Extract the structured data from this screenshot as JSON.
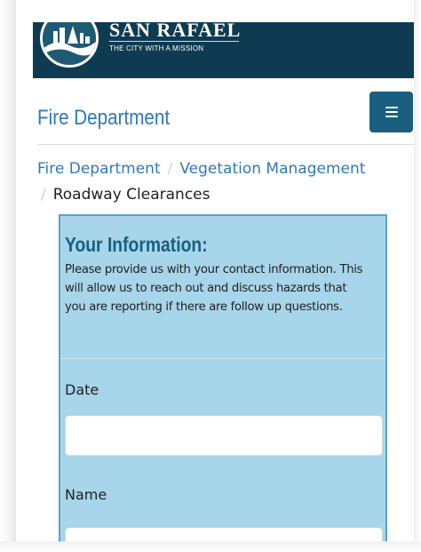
{
  "header": {
    "brand_name": "SAN RAFAEL",
    "tagline": "THE CITY WITH A MISSION",
    "bg_color": "#0f3b52"
  },
  "department": {
    "title": "Fire Department",
    "menu_icon": "hamburger-icon"
  },
  "breadcrumb": {
    "items": [
      {
        "label": "Fire Department",
        "link": true
      },
      {
        "label": "Vegetation Management",
        "link": true
      },
      {
        "label": "Roadway Clearances",
        "link": false
      }
    ],
    "separator": "/"
  },
  "form": {
    "section_title": "Your Information:",
    "section_description": "Please provide us with your contact information. This will allow us to reach out and discuss hazards that you are reporting if there are follow up questions.",
    "fields": [
      {
        "label": "Date",
        "value": ""
      },
      {
        "label": "Name",
        "value": ""
      }
    ],
    "panel_color": "#a7d5ea",
    "accent_color": "#1b5f80",
    "link_color": "#2f79b8"
  }
}
